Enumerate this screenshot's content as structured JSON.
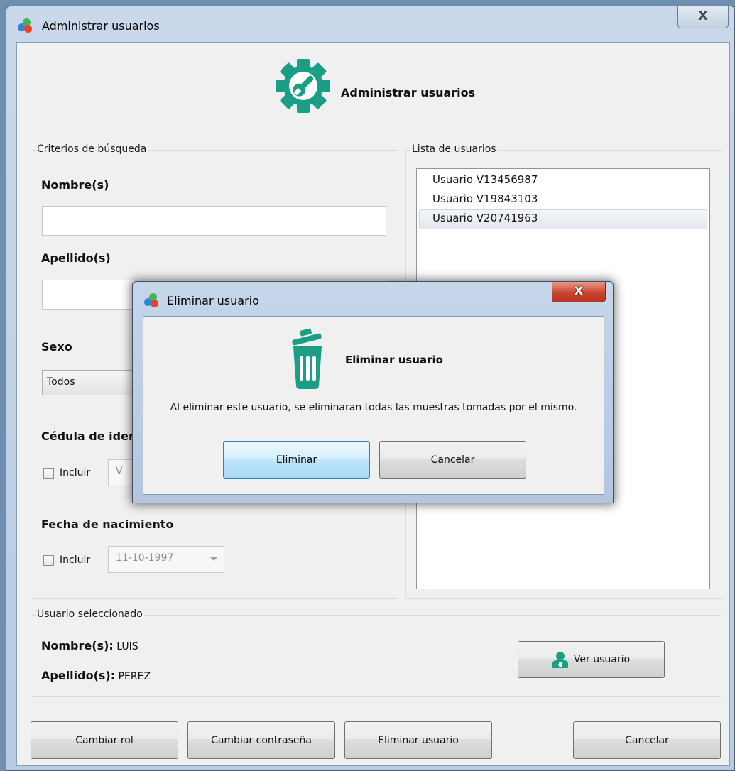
{
  "window": {
    "title": "Administrar usuarios",
    "close_glyph": "X",
    "icon": "app-logo-icon"
  },
  "header": {
    "title": "Administrar usuarios",
    "icon": "gear-wrench-icon",
    "accent": "#1a9e86"
  },
  "search": {
    "group_title": "Criterios de búsqueda",
    "nombre_label": "Nombre(s)",
    "nombre_value": "",
    "apellido_label": "Apellido(s)",
    "apellido_value": "",
    "sexo_label": "Sexo",
    "sexo_value": "Todos",
    "cedula_label": "Cédula de iden",
    "cedula_check": "Incluir",
    "cedula_prefix": "V",
    "fecha_label": "Fecha de nacimiento",
    "fecha_check": "Incluir",
    "fecha_value": "11-10-1997"
  },
  "userlist": {
    "group_title": "Lista de usuarios",
    "items": [
      {
        "label": "Usuario V13456987"
      },
      {
        "label": "Usuario V19843103"
      },
      {
        "label": "Usuario V20741963",
        "selected": true
      }
    ]
  },
  "selected": {
    "group_title": "Usuario seleccionado",
    "nombre_label": "Nombre(s):",
    "nombre_value": "LUIS",
    "apellido_label": "Apellido(s):",
    "apellido_value": "PEREZ",
    "view_button": "Ver usuario",
    "view_icon": "user-doctor-icon"
  },
  "buttons": {
    "cambiar_rol": "Cambiar rol",
    "cambiar_contrasena": "Cambiar contraseña",
    "eliminar_usuario": "Eliminar usuario",
    "cancelar": "Cancelar"
  },
  "dialog": {
    "title": "Eliminar usuario",
    "close_glyph": "X",
    "heading": "Eliminar usuario",
    "icon": "trash-icon",
    "message": "Al eliminar este usuario, se eliminaran todas las muestras tomadas por el mismo.",
    "confirm": "Eliminar",
    "cancel": "Cancelar"
  }
}
